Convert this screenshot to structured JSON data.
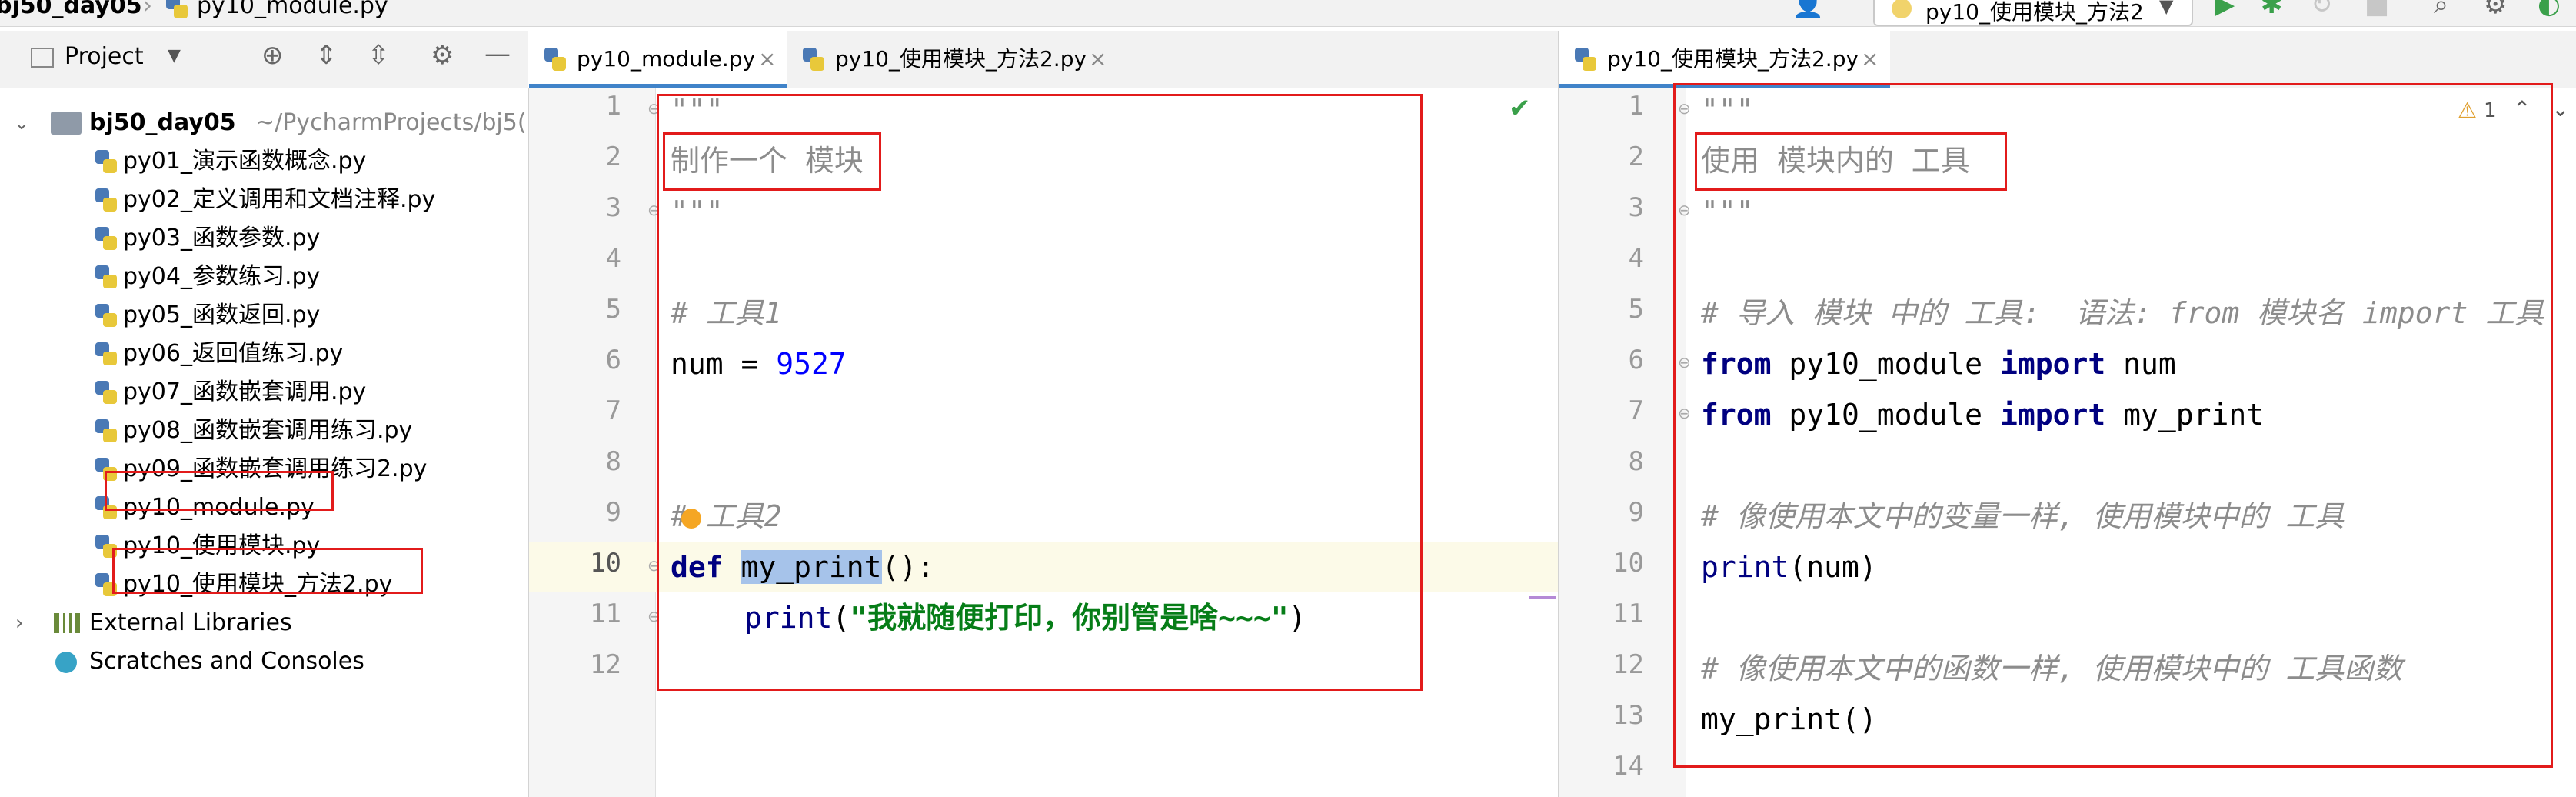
{
  "navbar": {
    "project_crumb": "bj50_day05",
    "file_crumb": "py10_module.py",
    "run_config": "py10_使用模块_方法2"
  },
  "project_panel": {
    "title": "Project",
    "root": {
      "name": "bj50_day05",
      "path": "~/PycharmProjects/bj5("
    },
    "files": [
      "py01_演示函数概念.py",
      "py02_定义调用和文档注释.py",
      "py03_函数参数.py",
      "py04_参数练习.py",
      "py05_函数返回.py",
      "py06_返回值练习.py",
      "py07_函数嵌套调用.py",
      "py08_函数嵌套调用练习.py",
      "py09_函数嵌套调用练习2.py",
      "py10_module.py",
      "py10_使用模块.py",
      "py10_使用模块_方法2.py"
    ],
    "external_libraries": "External Libraries",
    "scratches": "Scratches and Consoles"
  },
  "left_editor": {
    "tabs": [
      "py10_module.py",
      "py10_使用模块_方法2.py"
    ],
    "line_numbers": [
      "1",
      "2",
      "3",
      "4",
      "5",
      "6",
      "7",
      "8",
      "9",
      "10",
      "11",
      "12"
    ],
    "lines": {
      "l1": "\"\"\"",
      "l2": "制作一个 模块",
      "l3": "\"\"\"",
      "l5": "# 工具1",
      "l6_a": "num = ",
      "l6_b": "9527",
      "l9": "# 工具2",
      "l10_kw": "def",
      "l10_name": "my_print",
      "l10_rest": "():",
      "l11_fn": "print",
      "l11_open": "(",
      "l11_str": "\"我就随便打印，你别管是啥~~~\"",
      "l11_close": ")"
    }
  },
  "right_editor": {
    "tab": "py10_使用模块_方法2.py",
    "warning_count": "1",
    "line_numbers": [
      "1",
      "2",
      "3",
      "4",
      "5",
      "6",
      "7",
      "8",
      "9",
      "10",
      "11",
      "12",
      "13",
      "14"
    ],
    "lines": {
      "l1": "\"\"\"",
      "l2": "使用 模块内的 工具",
      "l3": "\"\"\"",
      "l5": "# 导入 模块 中的 工具:  语法: from 模块名 import 工具",
      "l6_from": "from",
      "l6_mod": " py10_module ",
      "l6_import": "import",
      "l6_name": " num",
      "l7_from": "from",
      "l7_mod": " py10_module ",
      "l7_import": "import",
      "l7_name": " my_print",
      "l9": "# 像使用本文中的变量一样, 使用模块中的 工具",
      "l10_fn": "print",
      "l10_rest": "(num)",
      "l12": "# 像使用本文中的函数一样, 使用模块中的 工具函数",
      "l13": "my_print()"
    }
  },
  "colors": {
    "highlight_box": "#e21b1b",
    "keyword": "#000080",
    "number": "#0000ff",
    "string": "#067d17",
    "comment": "#8c8c8c",
    "current_line": "#fcfae8",
    "selection": "#a6c3ea",
    "tab_active_underline": "#4083c9"
  }
}
